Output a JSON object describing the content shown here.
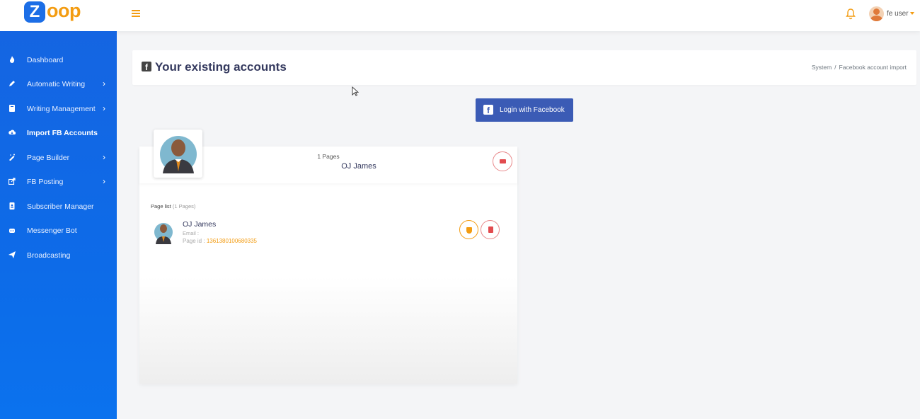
{
  "brand": {
    "z": "Z",
    "rest": "oop"
  },
  "header": {
    "user_name": "fe user"
  },
  "sidebar": {
    "items": [
      {
        "label": "Dashboard",
        "icon": "fire-icon",
        "chevron": false
      },
      {
        "label": "Automatic Writing",
        "icon": "pencil-icon",
        "chevron": true
      },
      {
        "label": "Writing Management",
        "icon": "book-icon",
        "chevron": true
      },
      {
        "label": "Import FB Accounts",
        "icon": "cloud-download-icon",
        "chevron": false,
        "active": true
      },
      {
        "label": "Page Builder",
        "icon": "magic-wand-icon",
        "chevron": true
      },
      {
        "label": "FB Posting",
        "icon": "share-icon",
        "chevron": true
      },
      {
        "label": "Subscriber Manager",
        "icon": "address-book-icon",
        "chevron": false
      },
      {
        "label": "Messenger Bot",
        "icon": "robot-icon",
        "chevron": false
      },
      {
        "label": "Broadcasting",
        "icon": "paper-plane-icon",
        "chevron": false
      }
    ],
    "chevron_glyph": "›"
  },
  "main": {
    "title": "Your existing accounts",
    "breadcrumb": [
      "System",
      "Facebook account import"
    ],
    "breadcrumb_sep": "/",
    "login_button": "Login with Facebook",
    "fb_glyph": "f"
  },
  "account": {
    "pages_count": "1 Pages",
    "name": "OJ James",
    "page_list_label": "Page list",
    "page_list_count": "(1 Pages)",
    "pages": [
      {
        "name": "OJ James",
        "email_label": "Email :",
        "id_label": "Page id :",
        "id_value": "1361380100680335"
      }
    ]
  },
  "colors": {
    "sidebar": "#1565e2",
    "accent": "#f39c12",
    "facebook": "#3b5bb5",
    "danger": "#e24b4f"
  }
}
